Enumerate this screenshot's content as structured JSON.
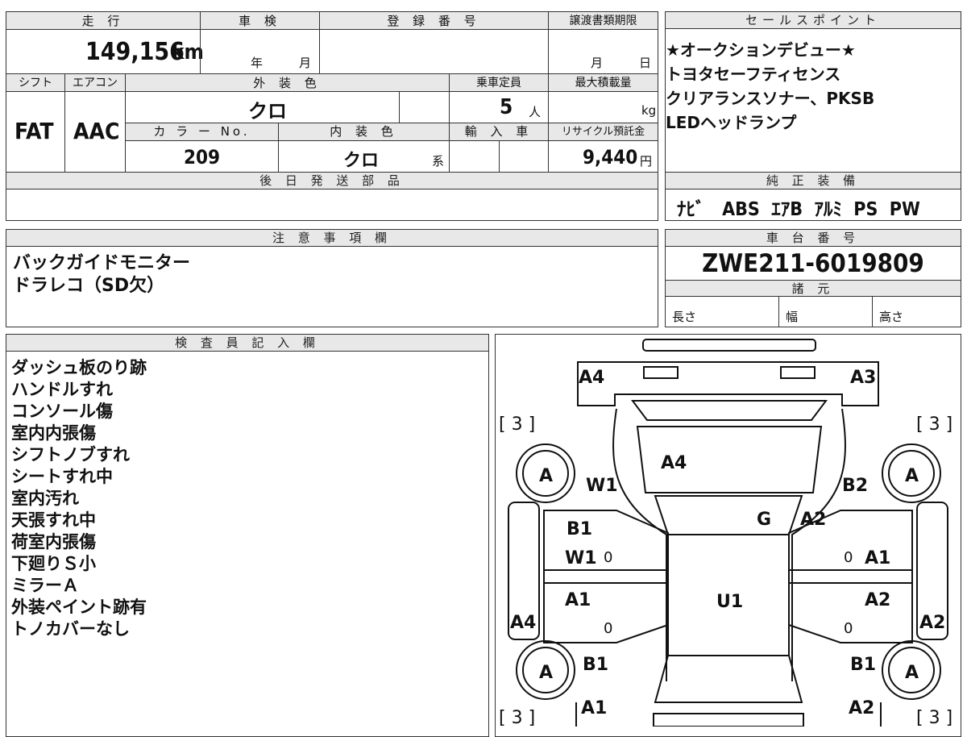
{
  "top_row": {
    "mileage_header": "走 行",
    "inspection_header": "車 検",
    "registration_header": "登 録 番 号",
    "transfer_header": "譲渡書類期限",
    "mileage_value": "149,156",
    "mileage_unit": "km",
    "inspection_year": "年",
    "inspection_month": "月",
    "transfer_month": "月",
    "transfer_day": "日"
  },
  "second_row": {
    "shift_header": "シフト",
    "aircon_header": "エアコン",
    "exterior_header": "外 装 色",
    "capacity_header": "乗車定員",
    "max_load_header": "最大積載量",
    "shift_value": "FAT",
    "aircon_value": "AAC",
    "exterior_value": "クロ",
    "capacity_value": "5",
    "capacity_unit": "人",
    "max_load_unit": "kg",
    "color_no_header": "カ ラ ー No.",
    "interior_header": "内 装 色",
    "import_header": "輸 入 車",
    "recycle_header": "リサイクル預託金",
    "color_no_value": "209",
    "interior_value": "クロ",
    "interior_suffix": "系",
    "recycle_value": "9,440",
    "recycle_unit": "円"
  },
  "later_parts": {
    "header": "後 日 発 送 部 品"
  },
  "sales_points": {
    "header": "セールスポイント",
    "lines": [
      "★オークションデビュー★",
      "トヨタセーフティセンス",
      "クリアランスソナー、PKSB",
      "LEDヘッドランプ"
    ]
  },
  "genuine_equipment": {
    "header": "純 正 装 備",
    "items": [
      "ﾅﾋﾞ",
      "ABS",
      "ｴｱB",
      "ｱﾙﾐ",
      "PS",
      "PW"
    ]
  },
  "notes": {
    "header": "注 意 事 項 欄",
    "lines": [
      "バックガイドモニター",
      "ドラレコ（SD欠）"
    ]
  },
  "chassis": {
    "header": "車 台 番 号",
    "value": "ZWE211-6019809",
    "specs_header": "諸 元",
    "length_label": "長さ",
    "width_label": "幅",
    "height_label": "高さ"
  },
  "inspector": {
    "header": "検 査 員 記 入 欄",
    "lines": [
      "ダッシュ板のり跡",
      "ハンドルすれ",
      "コンソール傷",
      "室内内張傷",
      "シフトノブすれ",
      "シートすれ中",
      "室内汚れ",
      "天張すれ中",
      "荷室内張傷",
      "下廻りＳ小",
      "ミラーＡ",
      "外装ペイント跡有",
      "トノカバーなし"
    ]
  },
  "diagram": {
    "rear_left": "A4",
    "rear_right": "A3",
    "bracket_tl": "[ 3 ]",
    "bracket_tr": "[ 3 ]",
    "bracket_bl": "[ 3 ]",
    "bracket_br": "[ 3 ]",
    "rear_glass": "A4",
    "wheel_tl": "A",
    "wheel_tr": "A",
    "wheel_bl": "A",
    "wheel_br": "A",
    "left_qtr": "W1",
    "right_qtr": "B2",
    "roof_front": "G",
    "right_rear_door_top": "A2",
    "left_rear_door_1": "B1",
    "left_rear_door_2": "W1",
    "left_zero_1": "0",
    "right_zero_1": "0",
    "right_rear_door": "A1",
    "left_front_door": "A1",
    "right_front_door": "A2",
    "roof": "U1",
    "left_side": "A4",
    "right_side": "A2",
    "left_zero_2": "0",
    "right_zero_2": "0",
    "left_fender": "B1",
    "right_fender": "B1",
    "front_left": "A1",
    "front_right": "A2"
  }
}
